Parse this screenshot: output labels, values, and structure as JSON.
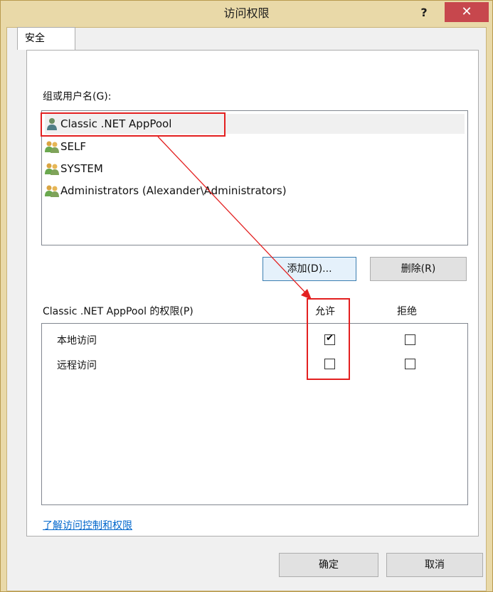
{
  "window": {
    "title": "访问权限",
    "help_glyph": "?",
    "close_glyph": "✕"
  },
  "tabs": [
    {
      "label": "安全"
    }
  ],
  "security": {
    "group_label": "组或用户名(G):",
    "users": [
      {
        "name": "Classic .NET AppPool",
        "icon": "single-user-icon",
        "selected": true
      },
      {
        "name": "SELF",
        "icon": "user-group-icon",
        "selected": false
      },
      {
        "name": "SYSTEM",
        "icon": "user-group-icon",
        "selected": false
      },
      {
        "name": "Administrators (Alexander\\Administrators)",
        "icon": "user-group-icon",
        "selected": false
      }
    ],
    "add_button": "添加(D)...",
    "remove_button": "删除(R)",
    "permissions_label": "Classic .NET AppPool 的权限(P)",
    "allow_header": "允许",
    "deny_header": "拒绝",
    "permissions": [
      {
        "name": "本地访问",
        "allow": true,
        "deny": false
      },
      {
        "name": "远程访问",
        "allow": false,
        "deny": false
      }
    ],
    "help_link": "了解访问控制和权限"
  },
  "footer": {
    "ok_button": "确定",
    "cancel_button": "取消"
  },
  "colors": {
    "window_frame": "#e9d9a8",
    "close_button": "#c7474d",
    "annotation": "#e32020",
    "link": "#0066cc"
  }
}
